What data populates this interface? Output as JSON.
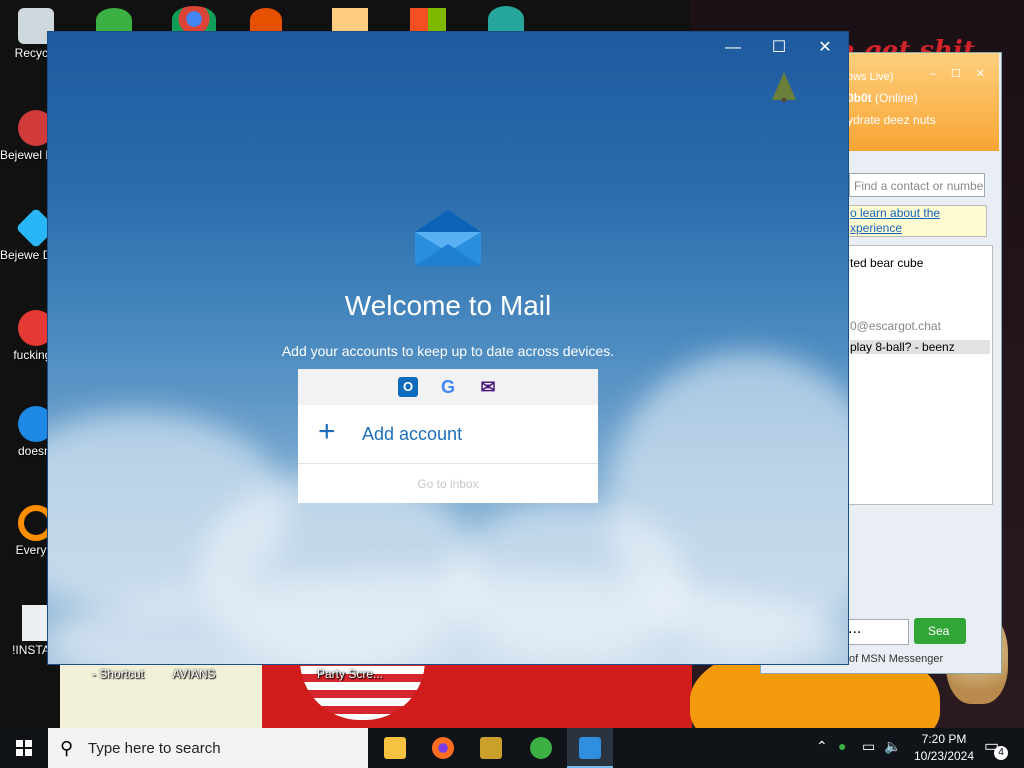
{
  "desktop": {
    "handwriting": "e get shit",
    "icons": [
      {
        "label": "Recycle",
        "icon": "recycle-bin-icon",
        "color": "#cfd8dc"
      },
      {
        "label": "Bejewel Delux",
        "icon": "bejeweled-icon",
        "color": "#d23b3b"
      },
      {
        "label": "Bejewe Delux",
        "icon": "bejeweled-diamond-icon",
        "color": "#29b6f6"
      },
      {
        "label": "fucking r",
        "icon": "red-creature-icon",
        "color": "#e53935"
      },
      {
        "label": "doesnt",
        "icon": "thunderbird-icon",
        "color": "#1e88e5"
      },
      {
        "label": "Everyth",
        "icon": "everything-search-icon",
        "color": "#ff8f00"
      },
      {
        "label": "!INSTALI",
        "icon": "document-icon",
        "color": "#eceff1"
      }
    ],
    "bottom_labels": [
      "- Shortcut",
      "AVIANS",
      "Party Scre..."
    ]
  },
  "msn": {
    "header_line1": "ows Live)",
    "user": "0b0t",
    "status": "(Online)",
    "message": "ydrate deez nuts",
    "search_placeholder": "Find a contact or numbe",
    "info_link_1": "o learn about the",
    "info_link_2": "xperience",
    "contacts": [
      "ted bear cube",
      "0@escargot.chat",
      "play 8-ball? - beenz"
    ],
    "search_input_placeholder": "...",
    "search_button": "Sea",
    "footer": "of MSN Messenger"
  },
  "mail": {
    "window_controls": {
      "minimize": "—",
      "maximize": "☐",
      "close": "✕"
    },
    "title": "Welcome to Mail",
    "subtitle": "Add your accounts to keep up to date across devices.",
    "providers": [
      {
        "name": "outlook-icon",
        "glyph": "O",
        "color": "#0f6cbd"
      },
      {
        "name": "google-icon",
        "glyph": "G",
        "color": "#4285f4"
      },
      {
        "name": "yahoo-mail-icon",
        "glyph": "✉",
        "color": "#4b1b7e"
      }
    ],
    "add_account": "Add account",
    "go_to_inbox": "Go to inbox",
    "accent": "#1f6fb8"
  },
  "taskbar": {
    "search_placeholder": "Type here to search",
    "apps": [
      {
        "name": "file-explorer-icon",
        "color": "#f5c242"
      },
      {
        "name": "firefox-icon",
        "color": "#ff6d1f"
      },
      {
        "name": "de-app-icon",
        "color": "#c8a02a"
      },
      {
        "name": "msn-messenger-icon",
        "color": "#3cb043"
      },
      {
        "name": "mail-icon",
        "color": "#2f8ee0"
      }
    ],
    "time": "7:20 PM",
    "date": "10/23/2024",
    "notifications": "4"
  }
}
